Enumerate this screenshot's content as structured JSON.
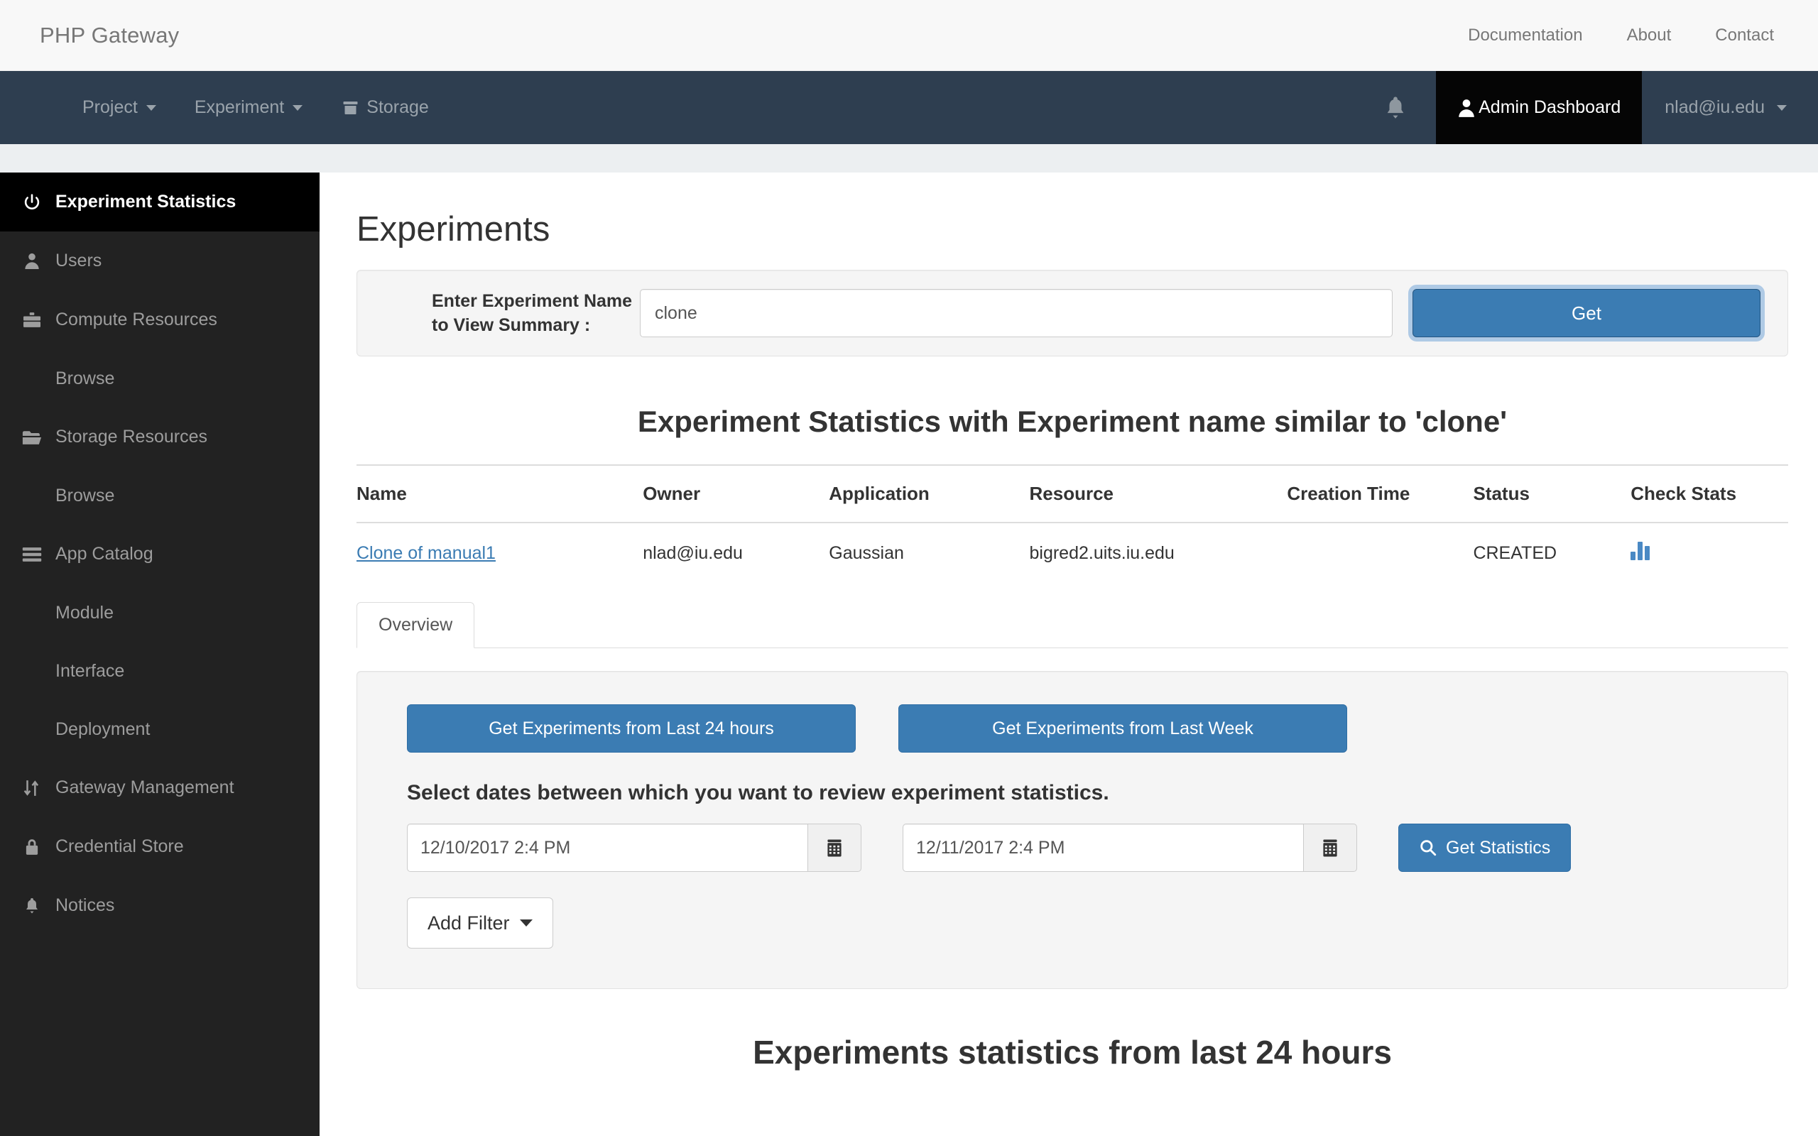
{
  "brand": {
    "title": "PHP Gateway",
    "links": [
      {
        "label": "Documentation"
      },
      {
        "label": "About"
      },
      {
        "label": "Contact"
      }
    ]
  },
  "navbar": {
    "items": [
      {
        "label": "Project",
        "icon": "caret-down-icon",
        "has_caret": true
      },
      {
        "label": "Experiment",
        "icon": "caret-down-icon",
        "has_caret": true
      },
      {
        "label": "Storage",
        "icon": "folder-icon",
        "has_caret": false
      }
    ],
    "bell_icon": "bell-icon",
    "admin_label": "Admin Dashboard",
    "admin_icon": "user-icon",
    "user_label": "nlad@iu.edu",
    "admin_bg": "#050505",
    "navbar_bg": "#2e3e50"
  },
  "sidebar": {
    "items": [
      {
        "label": "Experiment Statistics",
        "icon": "power-icon",
        "active": true,
        "sub": false
      },
      {
        "label": "Users",
        "icon": "user-icon",
        "active": false,
        "sub": false
      },
      {
        "label": "Compute Resources",
        "icon": "briefcase-icon",
        "active": false,
        "sub": false
      },
      {
        "label": "Browse",
        "icon": "",
        "active": false,
        "sub": true
      },
      {
        "label": "Storage Resources",
        "icon": "folder-open-icon",
        "active": false,
        "sub": false
      },
      {
        "label": "Browse",
        "icon": "",
        "active": false,
        "sub": true
      },
      {
        "label": "App Catalog",
        "icon": "list-icon",
        "active": false,
        "sub": false
      },
      {
        "label": "Module",
        "icon": "",
        "active": false,
        "sub": true
      },
      {
        "label": "Interface",
        "icon": "",
        "active": false,
        "sub": true
      },
      {
        "label": "Deployment",
        "icon": "",
        "active": false,
        "sub": true
      },
      {
        "label": "Gateway Management",
        "icon": "sort-icon",
        "active": false,
        "sub": false
      },
      {
        "label": "Credential Store",
        "icon": "lock-icon",
        "active": false,
        "sub": false
      },
      {
        "label": "Notices",
        "icon": "bell-icon",
        "active": false,
        "sub": false
      }
    ]
  },
  "main": {
    "page_title": "Experiments",
    "search": {
      "label": "Enter Experiment Name to View Summary :",
      "value": "clone",
      "placeholder": "",
      "button_label": "Get"
    },
    "stats_heading": "Experiment Statistics with Experiment name similar to 'clone'",
    "table": {
      "columns": [
        "Name",
        "Owner",
        "Application",
        "Resource",
        "Creation Time",
        "Status",
        "Check Stats"
      ],
      "rows": [
        {
          "name": "Clone of manual1",
          "owner": "nlad@iu.edu",
          "application": "Gaussian",
          "resource": "bigred2.uits.iu.edu",
          "creation_time": "",
          "status": "CREATED",
          "check_stats_icon": "bar-chart-icon"
        }
      ]
    },
    "tabs": [
      {
        "label": "Overview",
        "active": true
      }
    ],
    "panel": {
      "btn_last24": "Get Experiments from Last 24 hours",
      "btn_lastweek": "Get Experiments from Last Week",
      "note": "Select dates between which you want to review experiment statistics.",
      "date_from": "12/10/2017 2:4 PM",
      "date_to": "12/11/2017 2:4 PM",
      "calendar_icon": "calendar-icon",
      "get_statistics_label": "Get Statistics",
      "get_statistics_icon": "search-icon",
      "add_filter_label": "Add Filter"
    },
    "bottom_heading": "Experiments statistics from last 24 hours"
  },
  "colors": {
    "primary_blue": "#3b7cb3",
    "link_blue": "#3b7cb3",
    "navbar_dark": "#2e3e50",
    "sidebar_dark": "#222222",
    "sidebar_active": "#000000"
  }
}
